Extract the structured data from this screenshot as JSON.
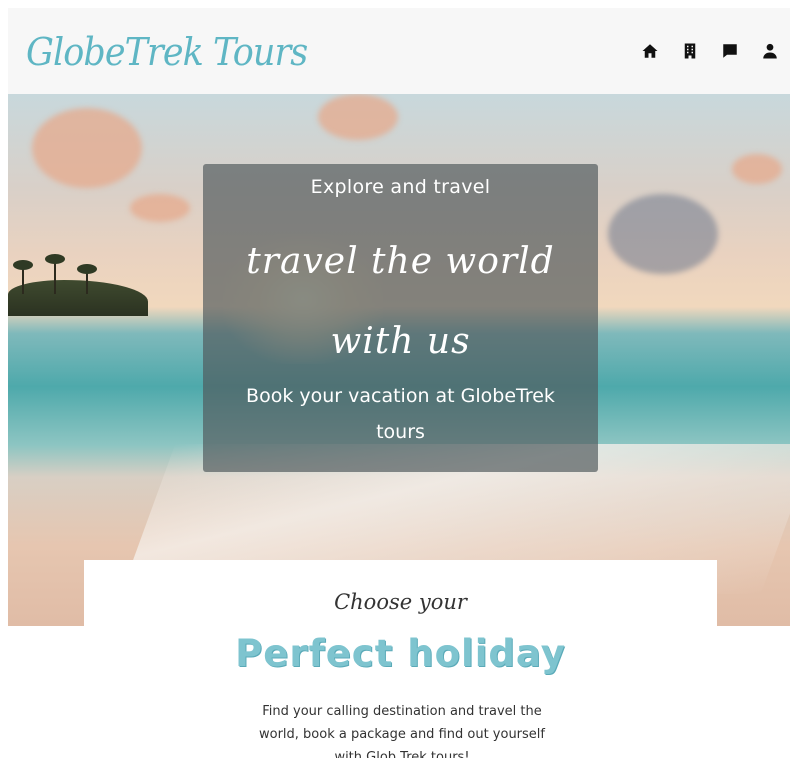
{
  "header": {
    "logo": "GlobeTrek Tours",
    "nav": [
      {
        "icon": "home-icon"
      },
      {
        "icon": "hotel-icon"
      },
      {
        "icon": "chat-icon"
      },
      {
        "icon": "user-icon"
      }
    ]
  },
  "hero": {
    "kicker": "Explore and travel",
    "headline": "travel the world with us",
    "subtitle": "Book your vacation at GlobeTrek tours"
  },
  "intro": {
    "eyebrow": "Choose your",
    "title": "Perfect holiday",
    "description": "Find your calling destination and travel the world, book a package and find out yourself with Glob Trek tours!"
  },
  "colors": {
    "brand": "#5fb6c4",
    "title_accent": "#7ec4cf",
    "overlay": "#50585c"
  }
}
